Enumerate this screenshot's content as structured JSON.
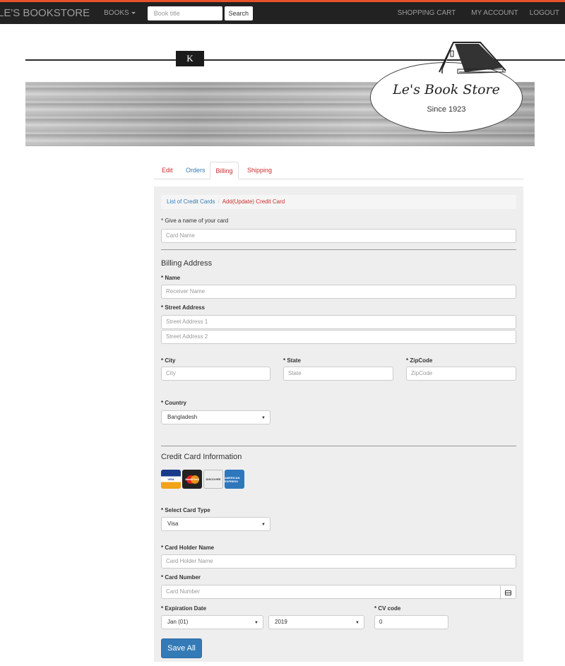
{
  "navbar": {
    "brand": "LE'S BOOKSTORE",
    "books_menu": "BOOKS",
    "search_placeholder": "Book title",
    "search_button": "Search",
    "right_links": [
      "SHOPPING CART",
      "MY ACCOUNT",
      "LOGOUT"
    ],
    "accent_color": "#e8512a"
  },
  "banner": {
    "k_label": "K",
    "store_name": "Le's Book Store",
    "since": "Since 1923"
  },
  "tabs": [
    {
      "label": "Edit"
    },
    {
      "label": "Orders"
    },
    {
      "label": "Billing",
      "active": true
    },
    {
      "label": "Shipping"
    }
  ],
  "breadcrumb": {
    "item1": "List of Credit Cards",
    "separator": "/",
    "item2": "Add(Update) Credit Card"
  },
  "form": {
    "card_name_label": "* Give a name of your card",
    "card_name_placeholder": "Card Name",
    "billing_heading": "Billing Address",
    "name_label": "* Name",
    "name_placeholder": "Receiver Name",
    "street_label": "* Street Address",
    "street1_placeholder": "Street Address 1",
    "street2_placeholder": "Street Address 2",
    "city_label": "* City",
    "city_placeholder": "City",
    "state_label": "* State",
    "state_placeholder": "State",
    "zip_label": "* ZipCode",
    "zip_placeholder": "ZipCode",
    "country_label": "* Country",
    "country_value": "Bangladesh",
    "cc_heading": "Credit Card Information",
    "card_logos": [
      "VISA",
      "MasterCard",
      "DISCOVER",
      "AMERICAN EXPRESS"
    ],
    "card_type_label": "* Select Card Type",
    "card_type_value": "Visa",
    "holder_label": "* Card Holder Name",
    "holder_placeholder": "Card Holder Name",
    "number_label": "* Card Number",
    "number_placeholder": "Card Number",
    "exp_label": "* Expiration Date",
    "exp_month_value": "Jan (01)",
    "exp_year_value": "2019",
    "cv_label": "* CV code",
    "cv_value": "0",
    "save_button": "Save All"
  }
}
